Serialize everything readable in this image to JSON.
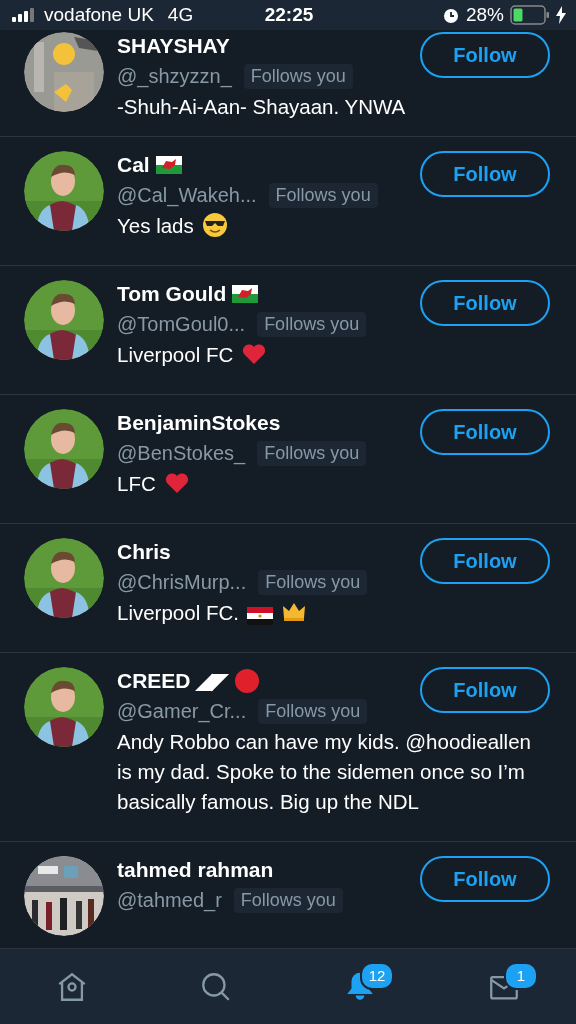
{
  "status_bar": {
    "carrier": "vodafone UK",
    "network": "4G",
    "time": "22:25",
    "battery": "28%"
  },
  "users": [
    {
      "name": "SHAYSHAY",
      "handle": "@_shzyzzn_",
      "follows_you": "Follows you",
      "bio": "-Shuh-Ai-Aan- Shayaan. YNWA",
      "button": "Follow"
    },
    {
      "name": "Cal",
      "name_icons": [
        {
          "kind": "wales-flag"
        }
      ],
      "handle": "@Cal_Wakeh...",
      "follows_you": "Follows you",
      "bio": "Yes lads",
      "bio_icons": [
        {
          "kind": "sunglasses-face"
        }
      ],
      "button": "Follow"
    },
    {
      "name": "Tom Gould",
      "name_icons": [
        {
          "kind": "wales-flag"
        }
      ],
      "handle": "@TomGoul0...",
      "follows_you": "Follows you",
      "bio": "Liverpool FC",
      "bio_icons": [
        {
          "kind": "heart"
        }
      ],
      "button": "Follow"
    },
    {
      "name": "BenjaminStokes",
      "handle": "@BenStokes_",
      "follows_you": "Follows you",
      "bio": "LFC",
      "bio_icons": [
        {
          "kind": "heart"
        }
      ],
      "button": "Follow"
    },
    {
      "name": "Chris",
      "handle": "@ChrisMurp...",
      "follows_you": "Follows you",
      "bio": "Liverpool FC.",
      "bio_icons": [
        {
          "kind": "egypt-flag"
        },
        {
          "kind": "crown"
        }
      ],
      "button": "Follow"
    },
    {
      "name": "CREED ◢◤",
      "name_icons": [
        {
          "kind": "red-circle"
        }
      ],
      "handle": "@Gamer_Cr...",
      "follows_you": "Follows you",
      "bio": "Andy Robbo can have my kids. @hoodieallen is my dad. Spoke to the sidemen once so I’m basically famous. Big up the NDL",
      "button": "Follow"
    },
    {
      "name": "tahmed rahman",
      "handle": "@tahmed_r",
      "follows_you": "Follows you",
      "button": "Follow"
    }
  ],
  "tabs": [
    {
      "kind": "home",
      "selected": false
    },
    {
      "kind": "search",
      "selected": false
    },
    {
      "kind": "notifications",
      "selected": true,
      "badge": "12"
    },
    {
      "kind": "messages",
      "selected": false,
      "badge": "1"
    }
  ]
}
